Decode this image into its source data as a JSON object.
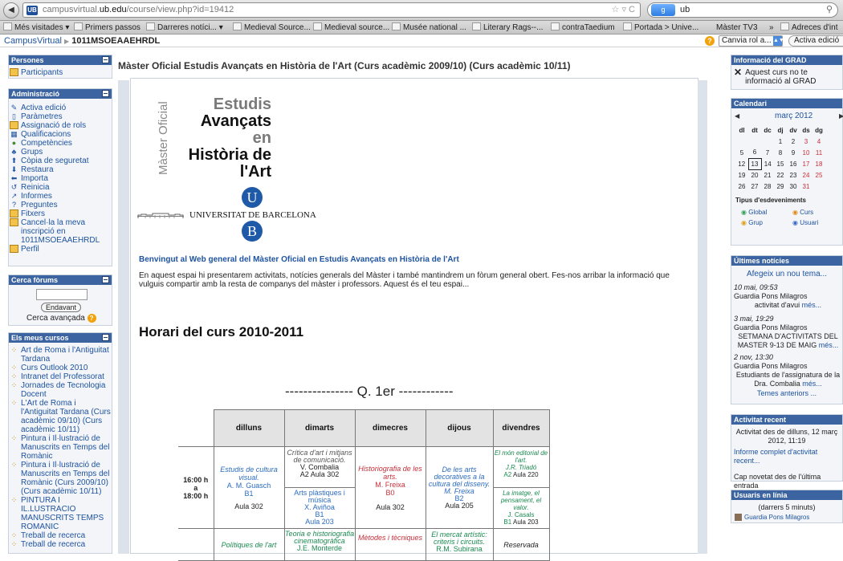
{
  "browser": {
    "url_prefix": "campusvirtual.",
    "url_domain": "ub.edu",
    "url_path": "/course/view.php?id=19412",
    "search_engine": "g",
    "search_text": "ub",
    "bookmarks": [
      "Més visitades ▾",
      "Primers passos",
      "Darreres notíci... ▾",
      "Medieval Source...",
      "Medieval source...",
      "Musée national ...",
      "Literary Rags--...",
      "contraTaedium",
      "Portada > Unive...",
      "Màster TV3",
      "»",
      "Adreces d'int"
    ]
  },
  "navbar": {
    "site": "CampusVirtual",
    "sep": "▶",
    "course": "1011MSOEAAEHRDL",
    "role_select": "Canvia rol a...",
    "edit_button": "Activa edició"
  },
  "left": {
    "persones": {
      "title": "Persones",
      "items": [
        "Participants"
      ]
    },
    "admin": {
      "title": "Administració",
      "items": [
        "Activa edició",
        "Paràmetres",
        "Assignació de rols",
        "Qualificacions",
        "Competències",
        "Grups",
        "Còpia de seguretat",
        "Restaura",
        "Importa",
        "Reinicia",
        "Informes",
        "Preguntes",
        "Fitxers",
        "Cancel·la la meva inscripció en 1011MSOEAAEHRDL",
        "Perfil"
      ]
    },
    "cerca": {
      "title": "Cerca fòrums",
      "button": "Endavant",
      "advanced": "Cerca avançada"
    },
    "cursos": {
      "title": "Els meus cursos",
      "items": [
        "Art de Roma i l'Antiguitat Tardana",
        "Curs Outlook 2010",
        "Intranet del Professorat",
        "Jornades de Tecnologia Docent",
        "L'Art de Roma i l'Antiguitat Tardana (Curs acadèmic 09/10) (Curs acadèmic 10/11)",
        "Pintura i Il·lustració de Manuscrits en Temps del Romànic",
        "Pintura i Il·lustració de Manuscrits en Temps del Romànic (Curs 2009/10) (Curs acadèmic 10/11)",
        "PINTURA I IL.LUSTRACIO MANUSCRITS TEMPS ROMANIC",
        "Treball de recerca",
        "Treball de recerca"
      ]
    }
  },
  "main": {
    "heading": "Màster Oficial Estudis Avançats en Història de l'Art (Curs acadèmic 2009/10) (Curs acadèmic 10/11)",
    "logo_side": "Màster Oficial",
    "logo_lines": [
      "Estudis",
      "Avançats",
      "en",
      "Història de",
      "l'Art"
    ],
    "ub_letters": [
      "U",
      "B"
    ],
    "ub_name": "UNIVERSITAT DE BARCELONA",
    "welcome": "Benvingut al Web general del Màster Oficial en Estudis Avançats en Història de l'Art",
    "description": "En aquest espai hi presentarem activitats, notícies generals del Màster i també mantindrem un fòrum general obert. Fes-nos arribar la informació que vulguis compartir amb la resta de companys del màster i professors. Aquest és el teu espai...",
    "horari": "Horari del curs 2010-2011",
    "quarter": "--------------- Q. 1er ------------",
    "days": [
      "dilluns",
      "dimarts",
      "dimecres",
      "dijous",
      "divendres"
    ],
    "time1": [
      "16:00 h",
      "a",
      "18:00 h"
    ],
    "row1": {
      "dilluns": [
        "Estudis de cultura visual.",
        "A. M. Guasch",
        "B1",
        "Aula 302"
      ],
      "dimarts_a": [
        "Crítica d'art i mitjans de comunicació.",
        "V. Combalia",
        "A2",
        "Aula 302"
      ],
      "dimarts_b": [
        "Arts plàstiques i música",
        "X. Aviñoa",
        "B1",
        "Aula 203"
      ],
      "dimecres": [
        "Historiografia de les arts.",
        "M. Freixa",
        "B0",
        "Aula 302"
      ],
      "dijous": [
        "De les arts decoratives a la cultura del disseny.",
        "M. Freixa",
        "B2",
        "Aula 205"
      ],
      "divendres_a": [
        "El món editorial de l'art.",
        "J.R. Triadó",
        "A2",
        "Aula 220"
      ],
      "divendres_b": [
        "La imatge, el pensament, el valor.",
        "J. Casals",
        "B1",
        "Aula 203"
      ]
    },
    "row2": {
      "dilluns": "Polítiques de l'art",
      "dimarts": [
        "Teoria e historiografia cinematogràfica",
        "J.E. Monterde"
      ],
      "dimecres": [
        "Mètodes i tècniques"
      ],
      "dijous": [
        "El mercat artístic: criteris i circuits.",
        "R.M. Subirana"
      ],
      "divendres": "Reservada"
    }
  },
  "right": {
    "info": {
      "title": "Informació del GRAD",
      "text": "Aquest curs no te informació al GRAD"
    },
    "cal": {
      "title": "Calendari",
      "month": "març 2012",
      "prev": "◀",
      "next": "▶",
      "dow": [
        "dl",
        "dt",
        "dc",
        "dj",
        "dv",
        "ds",
        "dg"
      ],
      "weeks": [
        [
          "",
          "",
          "",
          "1",
          "2",
          "3",
          "4"
        ],
        [
          "5",
          "6",
          "7",
          "8",
          "9",
          "10",
          "11"
        ],
        [
          "12",
          "13",
          "14",
          "15",
          "16",
          "17",
          "18"
        ],
        [
          "19",
          "20",
          "21",
          "22",
          "23",
          "24",
          "25"
        ],
        [
          "26",
          "27",
          "28",
          "29",
          "30",
          "31",
          ""
        ]
      ],
      "today": "13",
      "events_title": "Tipus d'esdeveniments",
      "events": [
        "Global",
        "Curs",
        "Grup",
        "Usuari"
      ]
    },
    "news": {
      "title": "Últimes notícies",
      "add": "Afegeix un nou tema...",
      "items": [
        {
          "date": "10 mai, 09:53",
          "author": "Guardia Pons Milagros",
          "text": "activitat d'avui",
          "more": "més..."
        },
        {
          "date": "3 mai, 19:29",
          "author": "Guardia Pons Milagros",
          "text": "SETMANA D'ACTIVITATS DEL MASTER 9-13 DE MAIG",
          "more": "més..."
        },
        {
          "date": "2 nov, 13:30",
          "author": "Guardia Pons Milagros",
          "text": "Estudiants de l'assignatura de la Dra. Combalia",
          "more": "més..."
        }
      ],
      "older": "Temes anteriors ..."
    },
    "recent": {
      "title": "Activitat recent",
      "since": "Activitat des de dilluns, 12 març 2012, 11:19",
      "report": "Informe complet d'activitat recent...",
      "none": "Cap novetat des de l'última entrada"
    },
    "online": {
      "title": "Usuaris en línia",
      "window": "(darrers 5 minuts)",
      "user": "Guardia Pons Milagros"
    }
  }
}
